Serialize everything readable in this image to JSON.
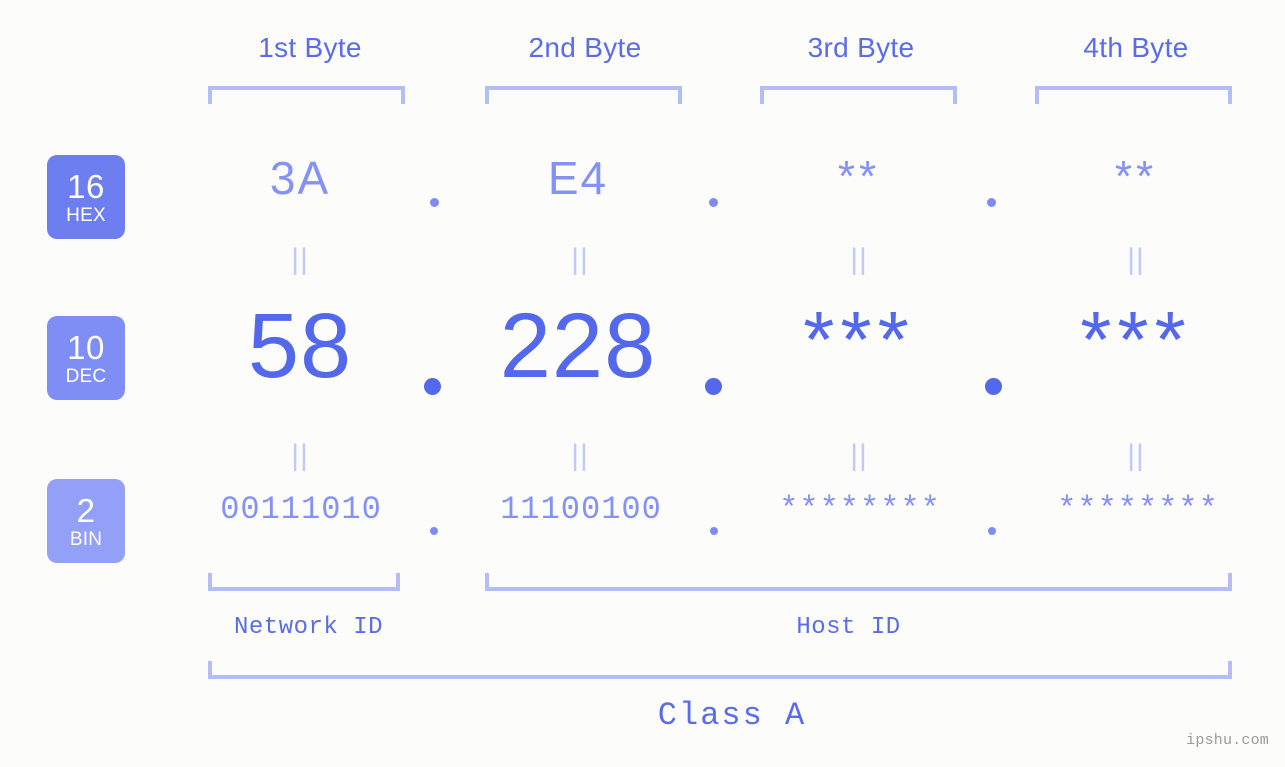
{
  "page": {
    "background": "#fcfdfa",
    "accent": "#5368ea",
    "accent_light": "#8492f5",
    "bracket_color": "#b3bdf7",
    "watermark": "ipshu.com"
  },
  "headers": [
    {
      "label": "1st Byte"
    },
    {
      "label": "2nd Byte"
    },
    {
      "label": "3rd Byte"
    },
    {
      "label": "4th Byte"
    }
  ],
  "bases": [
    {
      "num": "16",
      "name": "HEX",
      "color": "#6d7ef0"
    },
    {
      "num": "10",
      "name": "DEC",
      "color": "#7f8ef4"
    },
    {
      "num": "2",
      "name": "BIN",
      "color": "#92a0f8"
    }
  ],
  "rows": {
    "hex": {
      "values": [
        "3A",
        "E4",
        "**",
        "**"
      ]
    },
    "dec": {
      "values": [
        "58",
        "228",
        "***",
        "***"
      ]
    },
    "bin": {
      "values": [
        "00111010",
        "11100100",
        "********",
        "********"
      ]
    }
  },
  "equals": {
    "symbol": "||"
  },
  "separators": {
    "symbol": "."
  },
  "segments": {
    "network": "Network ID",
    "host": "Host ID",
    "class": "Class A"
  }
}
